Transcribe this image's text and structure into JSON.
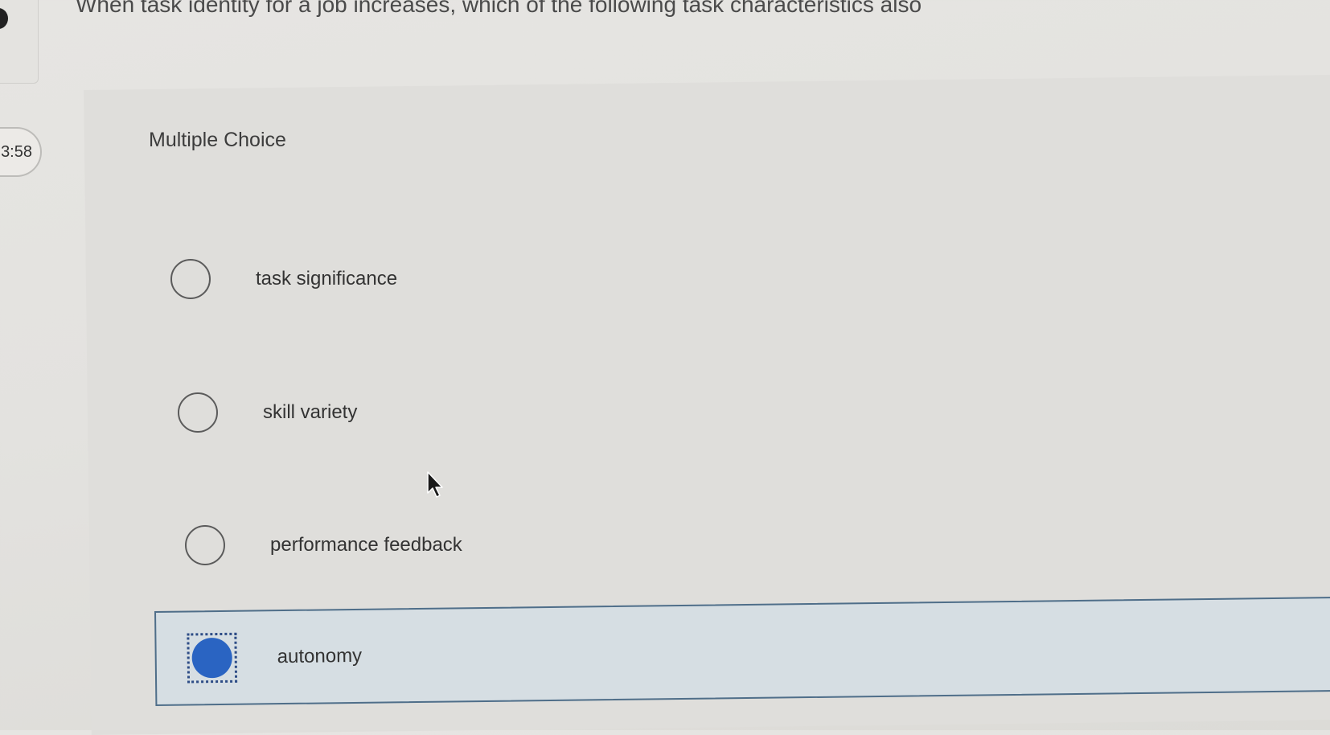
{
  "question": {
    "text": "When task identity for a job increases, which of the following task characteristics also"
  },
  "timer": {
    "label": "3:58"
  },
  "question_type": "Multiple Choice",
  "choices": [
    {
      "label": "task significance",
      "selected": false
    },
    {
      "label": "skill variety",
      "selected": false
    },
    {
      "label": "performance feedback",
      "selected": false
    },
    {
      "label": "autonomy",
      "selected": true
    }
  ],
  "colors": {
    "selected_fill": "#2a64c2",
    "selected_background": "#d6dee3",
    "selected_border": "#4f6e89"
  },
  "icons": {
    "cursor": "mouse-pointer-icon"
  }
}
